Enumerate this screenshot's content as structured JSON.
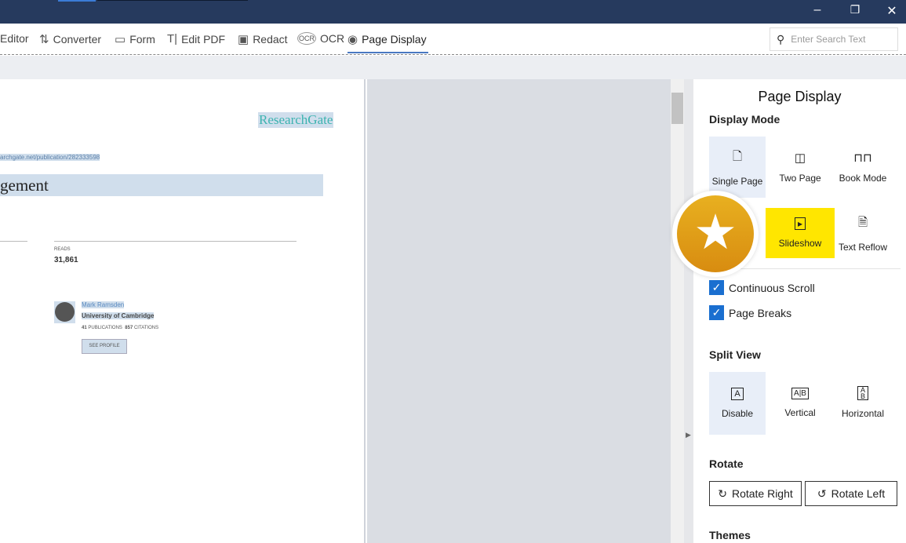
{
  "toolbar": {
    "items": [
      {
        "label": "Editor",
        "icon": "editor-icon"
      },
      {
        "label": "Converter",
        "icon": "converter-icon"
      },
      {
        "label": "Form",
        "icon": "form-icon"
      },
      {
        "label": "Edit PDF",
        "icon": "edit-pdf-icon"
      },
      {
        "label": "Redact",
        "icon": "redact-icon"
      },
      {
        "label": "OCR",
        "icon": "ocr-icon"
      },
      {
        "label": "Page Display",
        "icon": "eye-icon"
      }
    ],
    "active": "Page Display",
    "search_placeholder": "Enter Search Text"
  },
  "document": {
    "brand": "ResearchGate",
    "url": "archgate.net/publication/282333598",
    "title": "gement",
    "reads_label": "READS",
    "reads": "31,861",
    "author": {
      "name": "Mark Ramsden",
      "affiliation": "University of Cambridge",
      "publications": "41",
      "publications_label": "PUBLICATIONS",
      "citations": "857",
      "citations_label": "CITATIONS",
      "button": "SEE PROFILE"
    }
  },
  "panel": {
    "title": "Page Display",
    "display_mode": {
      "label": "Display Mode",
      "options": [
        "Single Page",
        "Two Page",
        "Book Mode",
        "Slideshow",
        "Text Reflow"
      ],
      "selected": "Single Page",
      "highlighted": "Slideshow"
    },
    "continuous_scroll": {
      "label": "Continuous Scroll",
      "checked": true
    },
    "page_breaks": {
      "label": "Page Breaks",
      "checked": true
    },
    "split_view": {
      "label": "Split View",
      "options": [
        "Disable",
        "Vertical",
        "Horizontal"
      ],
      "selected": "Disable"
    },
    "rotate": {
      "label": "Rotate",
      "right": "Rotate Right",
      "left": "Rotate Left"
    },
    "themes": {
      "label": "Themes"
    }
  },
  "colors": {
    "titlebar": "#263a5e",
    "accent": "#1a6fd0",
    "highlight": "#ffe600",
    "badge": "#e0a018"
  }
}
